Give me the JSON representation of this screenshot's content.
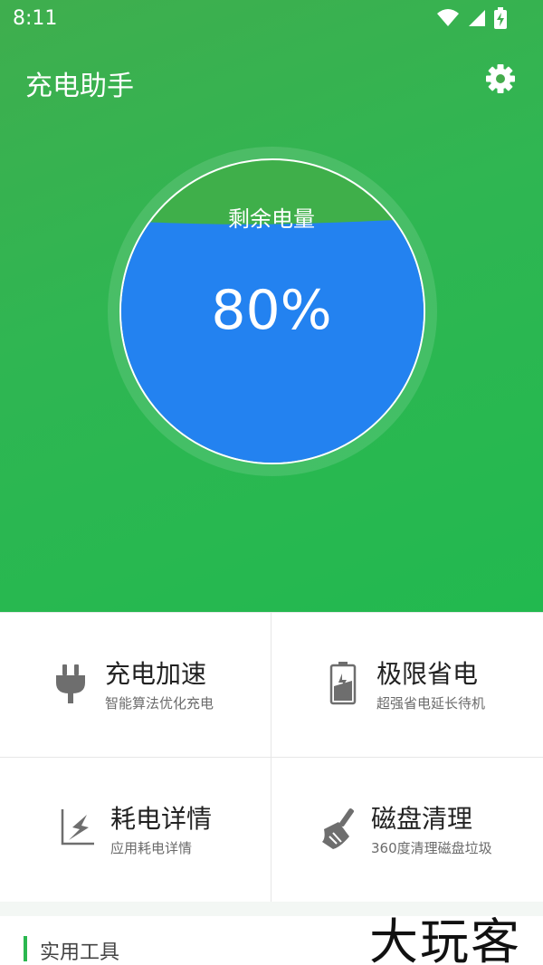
{
  "status_bar": {
    "time": "8:11"
  },
  "header": {
    "title": "充电助手",
    "settings_icon": "gear-icon"
  },
  "gauge": {
    "label": "剩余电量",
    "value_text": "80%",
    "level_percent": 80
  },
  "features": [
    {
      "title": "充电加速",
      "subtitle": "智能算法优化充电",
      "icon": "plug-icon"
    },
    {
      "title": "极限省电",
      "subtitle": "超强省电延长待机",
      "icon": "battery-saver-icon"
    },
    {
      "title": "耗电详情",
      "subtitle": "应用耗电详情",
      "icon": "power-usage-chart-icon"
    },
    {
      "title": "磁盘清理",
      "subtitle": "360度清理磁盘垃圾",
      "icon": "broom-icon"
    }
  ],
  "section": {
    "title": "实用工具"
  },
  "watermark": "大玩客",
  "colors": {
    "accent": "#2ab74f",
    "water": "#2382f0",
    "hero_bg": "#2fb652"
  }
}
